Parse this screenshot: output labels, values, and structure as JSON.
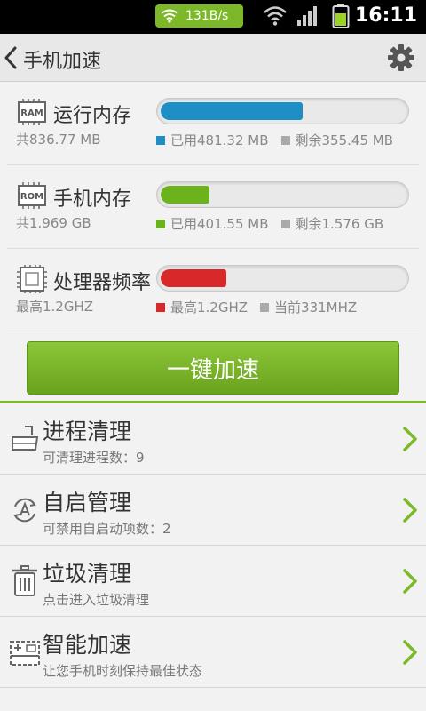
{
  "statusbar": {
    "net_speed": "131B/s",
    "time": "16:11",
    "icons": [
      "wifi-icon",
      "signal-icon",
      "battery-icon"
    ]
  },
  "header": {
    "title": "手机加速",
    "back_icon": "chevron-left-icon",
    "settings_icon": "gear-icon"
  },
  "resources": [
    {
      "icon_label": "RAM",
      "name": "运行内存",
      "total": "共836.77 MB",
      "fill_fraction": 0.58,
      "color": "#1e8fc6",
      "legend_used": "已用481.32 MB",
      "legend_free": "剩余355.45 MB"
    },
    {
      "icon_label": "ROM",
      "name": "手机内存",
      "total": "共1.969 GB",
      "fill_fraction": 0.2,
      "color": "#6cb31b",
      "legend_used": "已用401.55 MB",
      "legend_free": "剩余1.576 GB"
    },
    {
      "icon_label": "",
      "name": "处理器频率",
      "total": "最高1.2GHZ",
      "fill_fraction": 0.27,
      "color": "#d8282a",
      "legend_used": "最高1.2GHZ",
      "legend_free": "当前331MHZ"
    }
  ],
  "boost_button": {
    "label": "一键加速"
  },
  "menu": [
    {
      "title": "进程清理",
      "subtitle": "可清理进程数：9",
      "icon": "broom-icon"
    },
    {
      "title": "自启管理",
      "subtitle": "可禁用自启动项数：2",
      "icon": "autostart-icon"
    },
    {
      "title": "垃圾清理",
      "subtitle": "点击进入垃圾清理",
      "icon": "trash-icon"
    },
    {
      "title": "智能加速",
      "subtitle": "让您手机时刻保持最佳状态",
      "icon": "smart-boost-icon"
    }
  ],
  "colors": {
    "accent_green": "#7cb829",
    "legend_grey": "#aaaaaa"
  }
}
